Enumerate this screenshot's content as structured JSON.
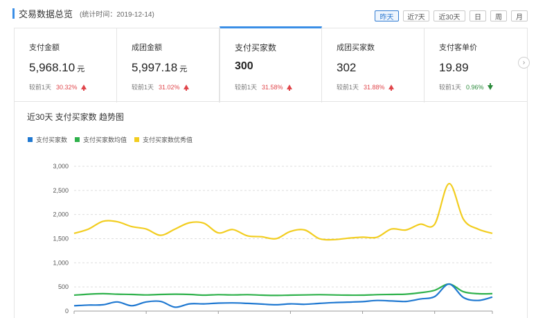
{
  "header": {
    "title": "交易数据总览",
    "stat_time": "(统计时间：2019-12-14)"
  },
  "periods": [
    {
      "label": "昨天",
      "active": true
    },
    {
      "label": "近7天",
      "active": false
    },
    {
      "label": "近30天",
      "active": false
    },
    {
      "label": "日",
      "active": false
    },
    {
      "label": "周",
      "active": false
    },
    {
      "label": "月",
      "active": false
    }
  ],
  "cards": [
    {
      "label": "支付金额",
      "value": "5,968.10",
      "unit": "元",
      "compare": "较前1天",
      "pct": "30.32%",
      "dir": "up"
    },
    {
      "label": "成团金额",
      "value": "5,997.18",
      "unit": "元",
      "compare": "较前1天",
      "pct": "31.02%",
      "dir": "up"
    },
    {
      "label": "支付买家数",
      "value": "300",
      "unit": "",
      "compare": "较前1天",
      "pct": "31.58%",
      "dir": "up"
    },
    {
      "label": "成团买家数",
      "value": "302",
      "unit": "",
      "compare": "较前1天",
      "pct": "31.88%",
      "dir": "up"
    },
    {
      "label": "支付客单价",
      "value": "19.89",
      "unit": "",
      "compare": "较前1天",
      "pct": "0.96%",
      "dir": "down"
    }
  ],
  "active_card": 2,
  "next_icon": "chevron-right-icon",
  "chart_title": "近30天 支付买家数 趋势图",
  "colors": {
    "accent": "#3a8ee6",
    "up": "#e0454a",
    "down": "#2a8a3a"
  },
  "chart_data": {
    "type": "line",
    "title": "近30天 支付买家数 趋势图",
    "ylim": [
      0,
      3000
    ],
    "yticks": [
      "3,000",
      "2,500",
      "2,000",
      "1,500",
      "1,000",
      "500",
      "0"
    ],
    "ytick_values": [
      3000,
      2500,
      2000,
      1500,
      1000,
      500,
      0
    ],
    "grid": true,
    "legend_position": "top-left",
    "x": [
      1,
      2,
      3,
      4,
      5,
      6,
      7,
      8,
      9,
      10,
      11,
      12,
      13,
      14,
      15,
      16,
      17,
      18,
      19,
      20,
      21,
      22,
      23,
      24,
      25,
      26,
      27,
      28,
      29,
      30
    ],
    "series": [
      {
        "name": "支付买家数",
        "color": "#1f78d1",
        "values": [
          110,
          125,
          130,
          190,
          110,
          190,
          200,
          80,
          150,
          150,
          165,
          170,
          160,
          145,
          130,
          150,
          140,
          160,
          175,
          185,
          195,
          220,
          210,
          200,
          250,
          300,
          560,
          280,
          220,
          290
        ]
      },
      {
        "name": "支付买家数均值",
        "color": "#2eb14b",
        "values": [
          330,
          350,
          360,
          350,
          345,
          335,
          345,
          350,
          345,
          330,
          340,
          335,
          340,
          330,
          325,
          330,
          335,
          340,
          335,
          330,
          330,
          340,
          345,
          350,
          380,
          430,
          560,
          400,
          360,
          360
        ]
      },
      {
        "name": "支付买家数优秀值",
        "color": "#f2cd1f",
        "values": [
          1610,
          1700,
          1860,
          1850,
          1750,
          1700,
          1570,
          1700,
          1830,
          1820,
          1620,
          1690,
          1560,
          1540,
          1500,
          1650,
          1680,
          1500,
          1480,
          1510,
          1530,
          1530,
          1700,
          1680,
          1800,
          1800,
          2640,
          1900,
          1700,
          1610
        ]
      }
    ]
  }
}
